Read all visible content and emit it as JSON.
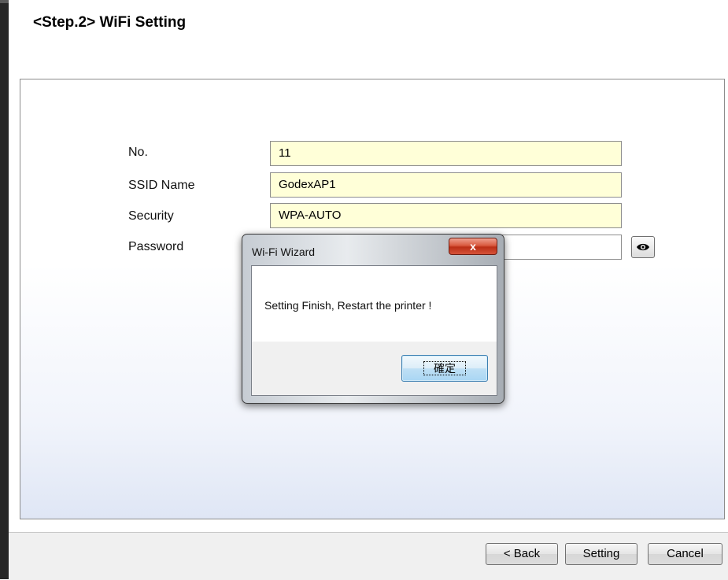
{
  "page": {
    "title": "<Step.2> WiFi Setting"
  },
  "form": {
    "no": {
      "label": "No.",
      "value": "11"
    },
    "ssid": {
      "label": "SSID Name",
      "value": "GodexAP1"
    },
    "security": {
      "label": "Security",
      "value": "WPA-AUTO"
    },
    "password": {
      "label": "Password",
      "value": ""
    }
  },
  "dialog": {
    "title": "Wi-Fi Wizard",
    "close_label": "x",
    "message": "Setting Finish, Restart the printer !",
    "ok_label": "確定"
  },
  "footer": {
    "back_label": "< Back",
    "setting_label": "Setting",
    "cancel_label": "Cancel"
  },
  "icons": {
    "password_toggle": "eye-icon",
    "dialog_close": "close-icon"
  }
}
